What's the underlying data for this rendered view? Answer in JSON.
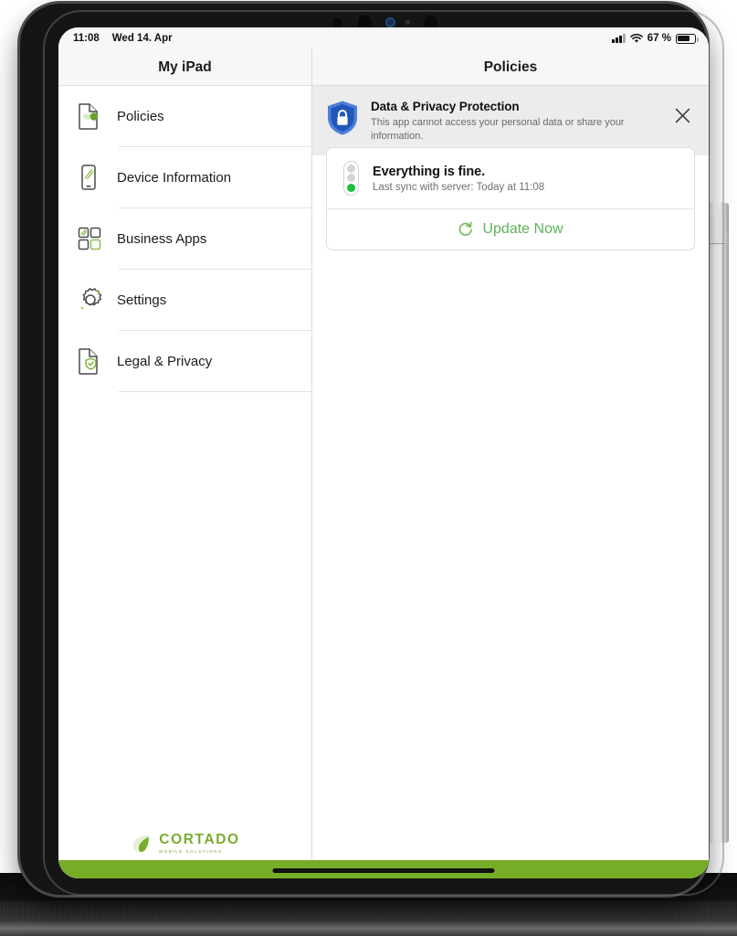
{
  "device": {
    "type": "ipad",
    "accessory": "apple-pencil"
  },
  "status_bar": {
    "time": "11:08",
    "date": "Wed 14. Apr",
    "cellular_icon": "signal-bars-icon",
    "wifi_icon": "wifi-icon",
    "battery_percent": "67 %",
    "battery_icon": "battery-icon"
  },
  "sidebar": {
    "title": "My iPad",
    "items": [
      {
        "label": "Policies",
        "icon": "document-policy-icon"
      },
      {
        "label": "Device Information",
        "icon": "device-info-icon"
      },
      {
        "label": "Business Apps",
        "icon": "app-grid-icon"
      },
      {
        "label": "Settings",
        "icon": "gear-icon"
      },
      {
        "label": "Legal & Privacy",
        "icon": "document-shield-icon"
      }
    ],
    "logo": {
      "name": "CORTADO",
      "tagline": "MOBILE SOLUTIONS",
      "icon": "cortado-leaf-icon",
      "color": "#7aad2e"
    }
  },
  "detail": {
    "title": "Policies",
    "banner": {
      "icon": "shield-lock-icon",
      "title": "Data & Privacy Protection",
      "body": "This app cannot access your personal data or share your information.",
      "close_icon": "close-icon",
      "background": "#ececec",
      "shield_color": "#2a5fc4"
    },
    "status_card": {
      "indicator_icon": "traffic-light-icon",
      "indicator_state": "green",
      "title": "Everything is fine.",
      "subtitle": "Last sync with server: Today at 11:08",
      "action_icon": "refresh-icon",
      "action_label": "Update Now",
      "action_color": "#5fb15a"
    }
  },
  "bottom_bar": {
    "color": "#76ac26",
    "home_indicator": "home-indicator"
  }
}
